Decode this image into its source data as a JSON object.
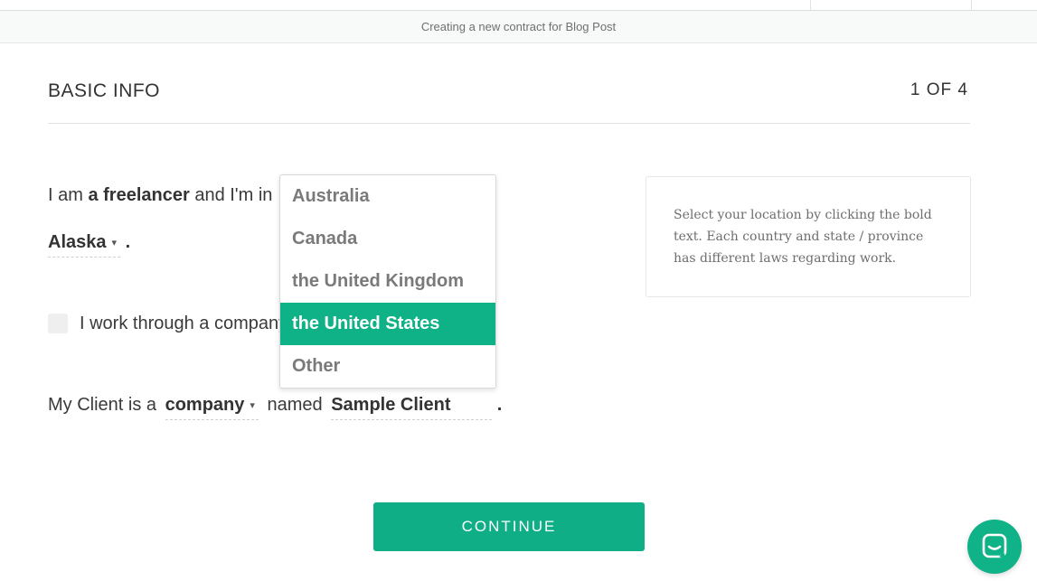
{
  "subheader": "Creating a new contract for Blog Post",
  "section": {
    "title": "BASIC INFO",
    "step": "1 OF 4"
  },
  "form": {
    "line1_prefix": "I am",
    "role": "a freelancer",
    "line1_mid": "and I'm in",
    "state": "Alaska",
    "period": ".",
    "company_label": "I work through a company",
    "client_prefix": "My Client is a",
    "client_type": "company",
    "client_mid": "named",
    "client_name": "Sample Client",
    "client_period": "."
  },
  "location_dropdown": {
    "options": [
      "Australia",
      "Canada",
      "the United Kingdom",
      "the United States",
      "Other"
    ],
    "selected": "the United States"
  },
  "hint": "Select your location by clicking the bold text. Each country and state / province has different laws regarding work.",
  "continue_label": "CONTINUE",
  "colors": {
    "accent": "#0fb186",
    "text": "#333333"
  },
  "chat_icon": "chat-bubble-icon"
}
